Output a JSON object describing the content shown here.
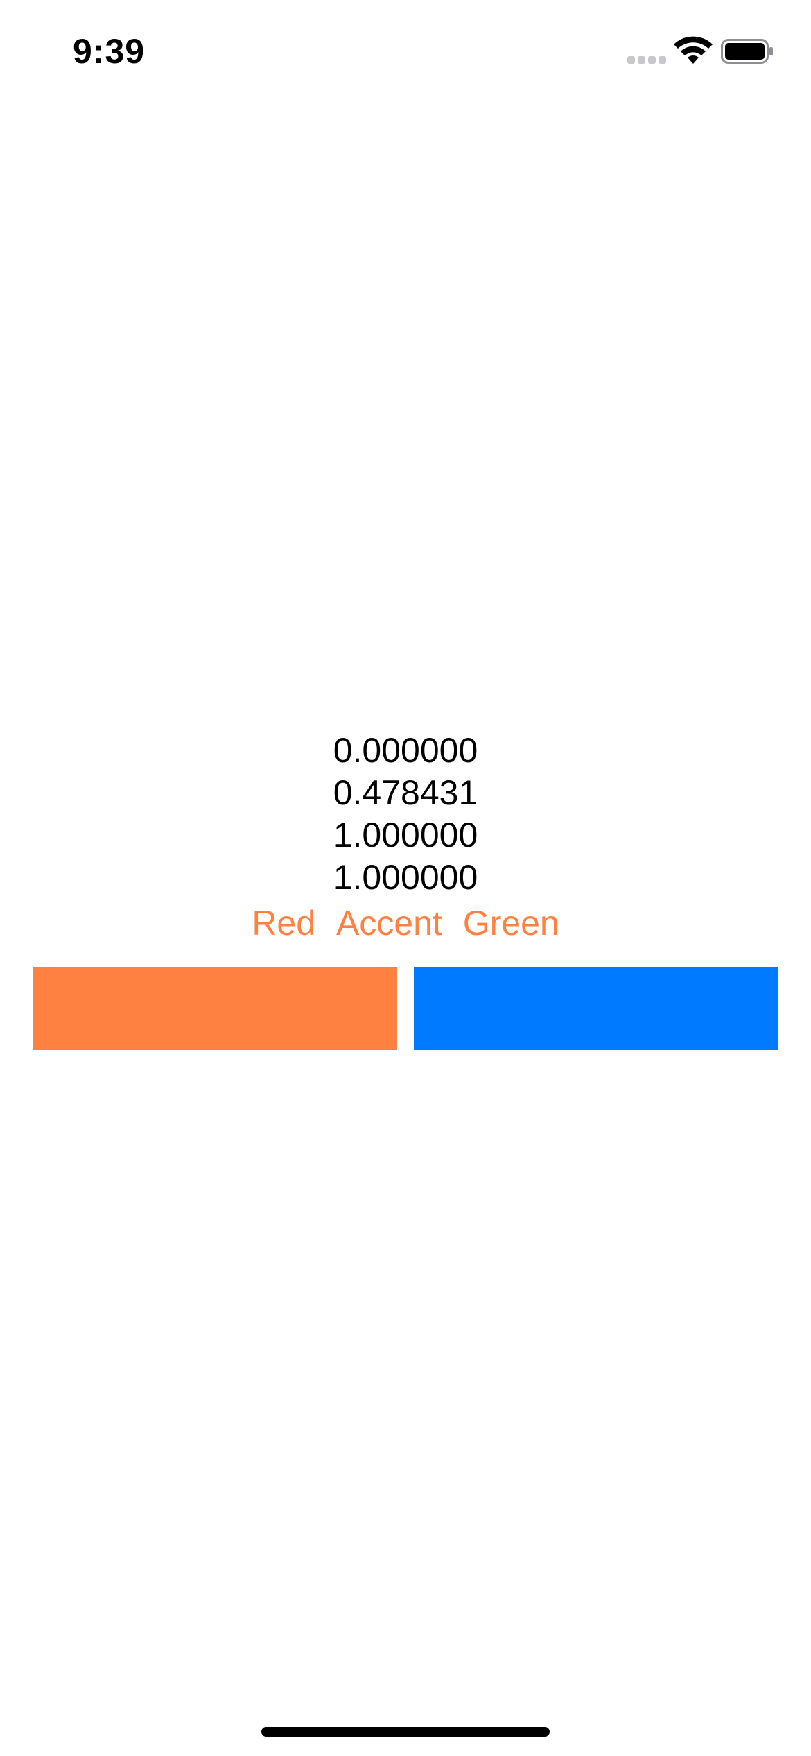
{
  "status_bar": {
    "time": "9:39",
    "signal_icon": "cellular-signal-icon",
    "wifi_icon": "wifi-icon",
    "battery_icon": "battery-icon"
  },
  "values": [
    "0.000000",
    "0.478431",
    "1.000000",
    "1.000000"
  ],
  "labels": [
    "Red",
    "Accent",
    "Green"
  ],
  "colors": {
    "label_text": "#FF8142",
    "left_swatch": "#FF8142",
    "right_swatch": "#007AFF",
    "home_indicator": "#000000"
  }
}
